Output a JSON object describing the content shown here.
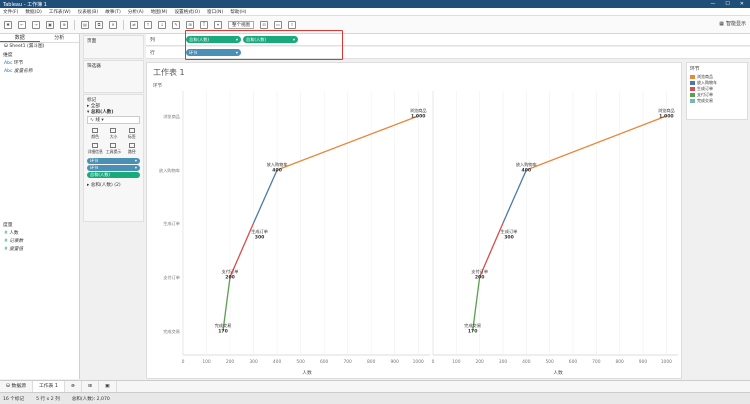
{
  "window": {
    "title": "Tableau - 工作簿 1"
  },
  "menu": [
    "文件(F)",
    "数据(D)",
    "工作表(W)",
    "仪表板(B)",
    "故事(T)",
    "分析(A)",
    "地图(M)",
    "设置格式(O)",
    "窗口(N)",
    "帮助(H)"
  ],
  "toolbar": {
    "fit": "整个视图",
    "smart_show": "智能显示"
  },
  "left": {
    "tabs": [
      "数据",
      "分析"
    ],
    "datasource": "Sheet1 (漏斗图)",
    "dimensions_title": "维度",
    "dimensions": [
      "环节",
      "度量名称"
    ],
    "measures_title": "度量",
    "measures": [
      "人数",
      "记录数",
      "度量值"
    ]
  },
  "cards": {
    "pages": "页面",
    "filters": "筛选器",
    "marks": "标记",
    "all": "全部",
    "group1": "总和(人数)",
    "mark_type": "线",
    "buttons": [
      "颜色",
      "大小",
      "标签",
      "详细信息",
      "工具提示",
      "路径"
    ],
    "mark_pills": [
      "环节",
      "环节",
      "总和(人数)"
    ],
    "group2": "总和(人数) (2)"
  },
  "shelves": {
    "columns_label": "列",
    "rows_label": "行",
    "columns": [
      "总和(人数)",
      "总和(人数)"
    ],
    "rows": [
      "环节"
    ]
  },
  "sheet": {
    "title": "工作表 1",
    "row_header": "环节",
    "xlabel": "人数"
  },
  "chart_data": {
    "type": "line",
    "categories": [
      "浏览商品",
      "放入购物车",
      "生成订单",
      "支付订单",
      "完成交易"
    ],
    "values": [
      1000,
      400,
      300,
      200,
      170
    ],
    "value_labels": [
      "1,000",
      "400",
      "300",
      "200",
      "170"
    ],
    "xticks": [
      "0",
      "100",
      "200",
      "300",
      "400",
      "500",
      "600",
      "700",
      "800",
      "900",
      "1000"
    ],
    "xlim": [
      0,
      1050
    ],
    "xlabel": "人数",
    "panes": 2,
    "colors": [
      "#e8873a",
      "#4e79a7",
      "#d64d4d",
      "#59a14f",
      "#76b7b2"
    ]
  },
  "legend": {
    "title": "环节",
    "items": [
      "浏览商品",
      "放入购物车",
      "生成订单",
      "支付订单",
      "完成交易"
    ]
  },
  "bottom_tabs": {
    "datasource": "数据源",
    "sheet": "工作表 1"
  },
  "status": [
    "16 个标记",
    "5 行 x 2 列",
    "总和(人数): 2,070"
  ]
}
